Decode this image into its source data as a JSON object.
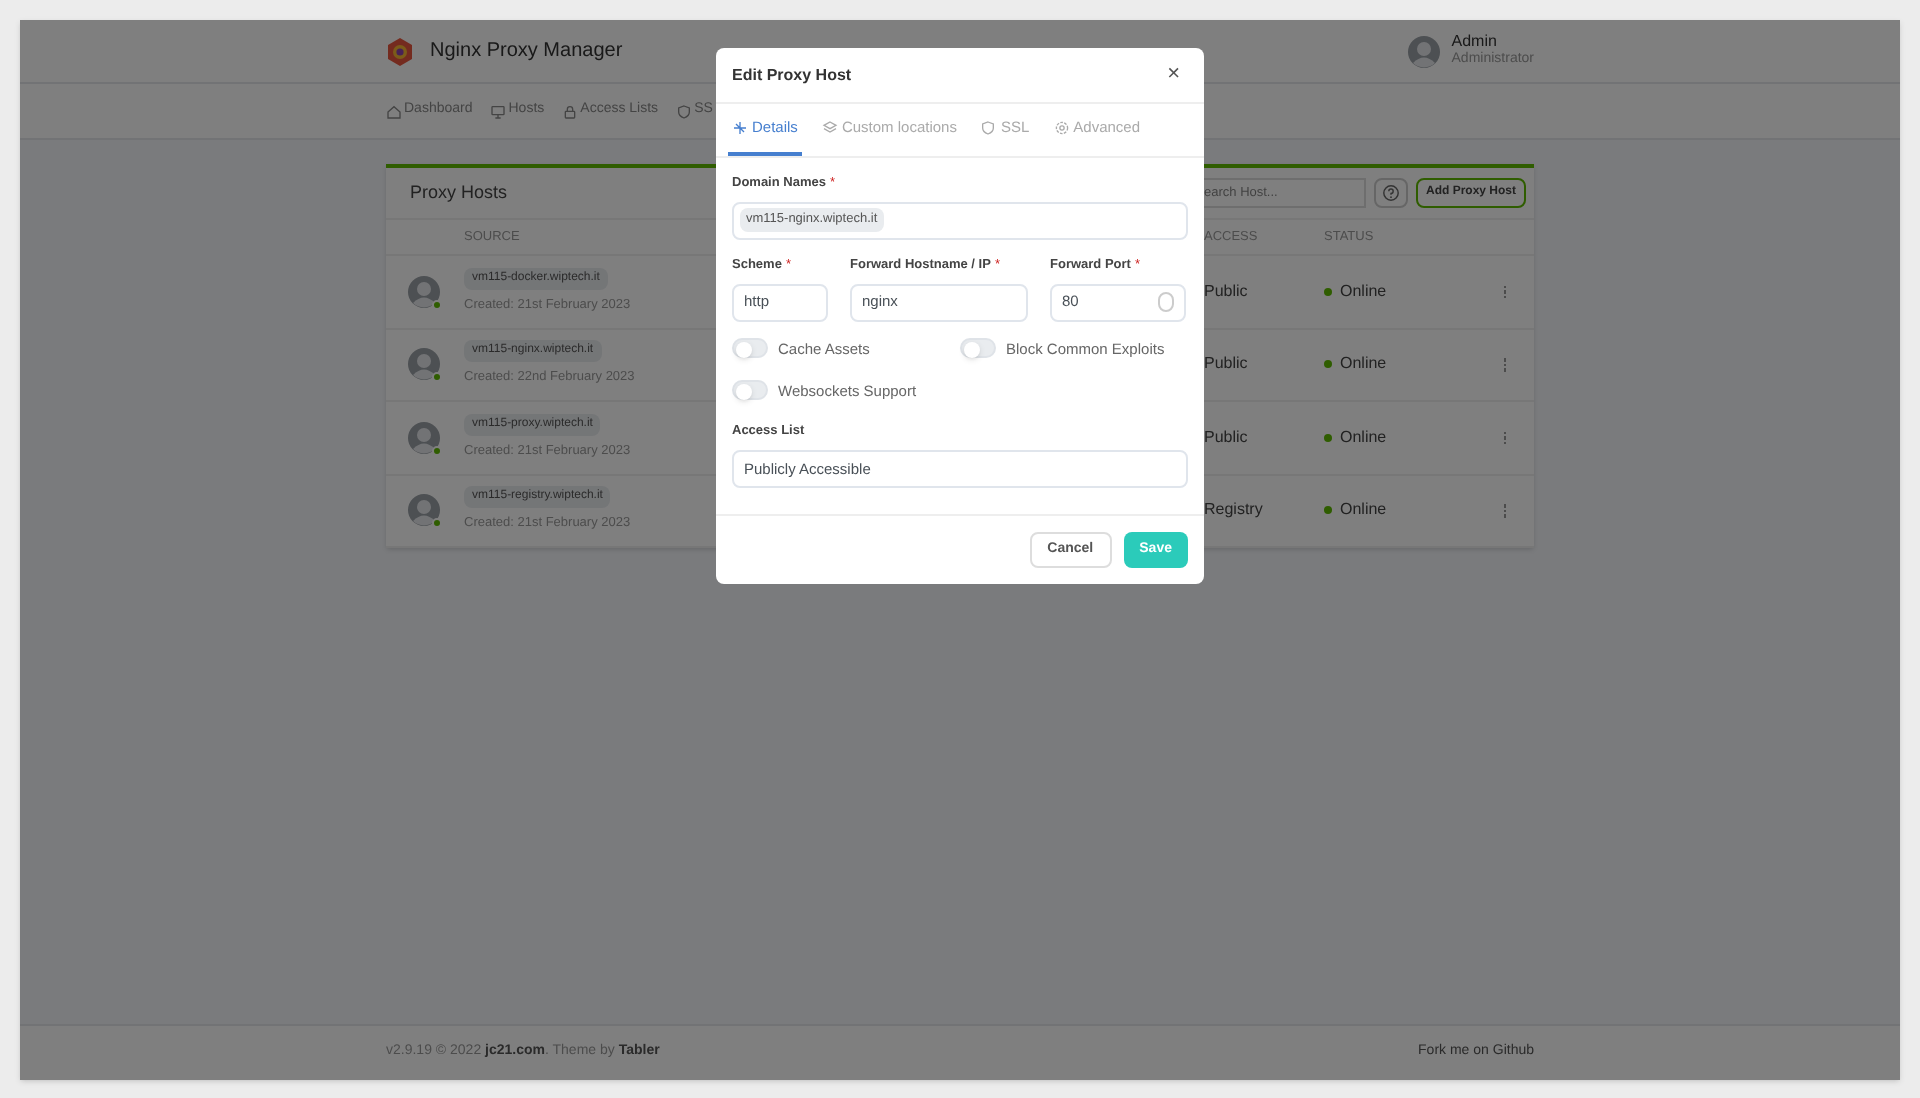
{
  "app": {
    "title": "Nginx Proxy Manager",
    "user": {
      "name": "Admin",
      "role": "Administrator"
    }
  },
  "nav": [
    {
      "label": "Dashboard"
    },
    {
      "label": "Hosts"
    },
    {
      "label": "Access Lists"
    },
    {
      "label": "SS"
    }
  ],
  "card": {
    "title": "Proxy Hosts",
    "search": {
      "placeholder": "earch Host..."
    },
    "add_button": "Add Proxy Host",
    "columns": [
      "SOURCE",
      "ACCESS",
      "STATUS"
    ],
    "rows": [
      {
        "domain": "vm115-docker.wiptech.it",
        "created": "Created: 21st February 2023",
        "access": "Public",
        "status": "Online",
        "online": true
      },
      {
        "domain": "vm115-nginx.wiptech.it",
        "created": "Created: 22nd February 2023",
        "access": "Public",
        "status": "Online",
        "online": true
      },
      {
        "domain": "vm115-proxy.wiptech.it",
        "created": "Created: 21st February 2023",
        "access": "Public",
        "status": "Online",
        "online": true
      },
      {
        "domain": "vm115-registry.wiptech.it",
        "created": "Created: 21st February 2023",
        "access": "Registry",
        "status": "Online",
        "online": true
      }
    ]
  },
  "footer": {
    "version": "v2.9.19 © 2022",
    "link_1": "jc21.com",
    "middle": ". Theme by",
    "link_2": "Tabler",
    "github": "Fork me on Github"
  },
  "modal": {
    "title": "Edit Proxy Host",
    "close": "×",
    "required_mark": "*",
    "tabs": [
      {
        "label": "Details",
        "selected": true
      },
      {
        "label": "Custom locations",
        "selected": false
      },
      {
        "label": "SSL",
        "selected": false
      },
      {
        "label": "Advanced",
        "selected": false
      }
    ],
    "domain_names": {
      "label": "Domain Names",
      "required": true,
      "chips": [
        "vm115-nginx.wiptech.it"
      ]
    },
    "scheme": {
      "label": "Scheme",
      "required": true,
      "value": "http"
    },
    "forward_host": {
      "label": "Forward Hostname / IP",
      "required": true,
      "value": "nginx"
    },
    "forward_port": {
      "label": "Forward Port",
      "required": true,
      "value": "80"
    },
    "toggles": [
      {
        "label": "Cache Assets",
        "on": false
      },
      {
        "label": "Block Common Exploits",
        "on": false
      },
      {
        "label": "Websockets Support",
        "on": false
      }
    ],
    "access_list": {
      "label": "Access List",
      "value": "Publicly Accessible"
    },
    "buttons": {
      "cancel": "Cancel",
      "save": "Save"
    }
  }
}
